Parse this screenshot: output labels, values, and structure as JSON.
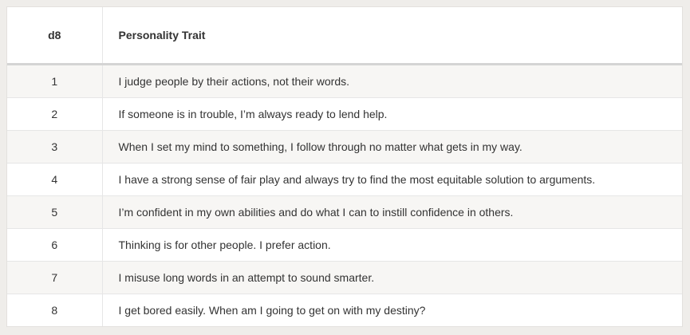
{
  "table": {
    "headers": [
      "d8",
      "Personality Trait"
    ],
    "rows": [
      [
        "1",
        "I judge people by their actions, not their words."
      ],
      [
        "2",
        "If someone is in trouble, I’m always ready to lend help."
      ],
      [
        "3",
        "When I set my mind to something, I follow through no matter what gets in my way."
      ],
      [
        "4",
        "I have a strong sense of fair play and always try to find the most equitable solution to arguments."
      ],
      [
        "5",
        "I’m confident in my own abilities and do what I can to instill confidence in others."
      ],
      [
        "6",
        "Thinking is for other people. I prefer action."
      ],
      [
        "7",
        "I misuse long words in an attempt to sound smarter."
      ],
      [
        "8",
        "I get bored easily. When am I going to get on with my destiny?"
      ]
    ]
  },
  "colors": {
    "page_background": "#efedea",
    "header_rule": "#d4d4d4",
    "row_stripe": "#f7f6f4",
    "text": "#333333"
  }
}
